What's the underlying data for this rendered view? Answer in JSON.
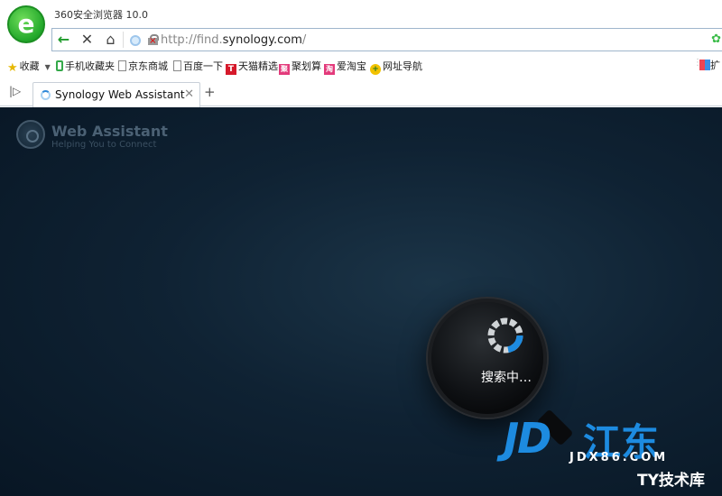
{
  "app": {
    "title": "360安全浏览器 10.0"
  },
  "nav": {
    "url_prefix": "http://find.",
    "url_domain": "synology.com",
    "url_suffix": "/"
  },
  "bookmarks": [
    {
      "label": "收藏",
      "icon": "star-icon"
    },
    {
      "label": "手机收藏夹",
      "icon": "phone-icon"
    },
    {
      "label": "京东商城",
      "icon": "page-icon"
    },
    {
      "label": "百度一下",
      "icon": "page-icon"
    },
    {
      "label": "天猫精选",
      "icon": "tmall-icon"
    },
    {
      "label": "聚划算",
      "icon": "juhuasuan-icon"
    },
    {
      "label": "爱淘宝",
      "icon": "aitaobao-icon"
    },
    {
      "label": "网址导航",
      "icon": "nav-icon"
    }
  ],
  "bookmarks_extra": "扩",
  "tabs": [
    {
      "title": "Synology Web Assistant"
    }
  ],
  "page": {
    "brand_title": "Web Assistant",
    "brand_subtitle": "Helping You to Connect",
    "status_text": "搜索中…"
  },
  "watermark": {
    "logo_text": "JD",
    "cn_text": "江东",
    "url_text": "JDX86.COM",
    "corner_text": "TY技术库"
  },
  "colors": {
    "accent_green": "#1f9b2b",
    "loader_blue": "#1d8be0",
    "page_bg": "#0f2233"
  }
}
